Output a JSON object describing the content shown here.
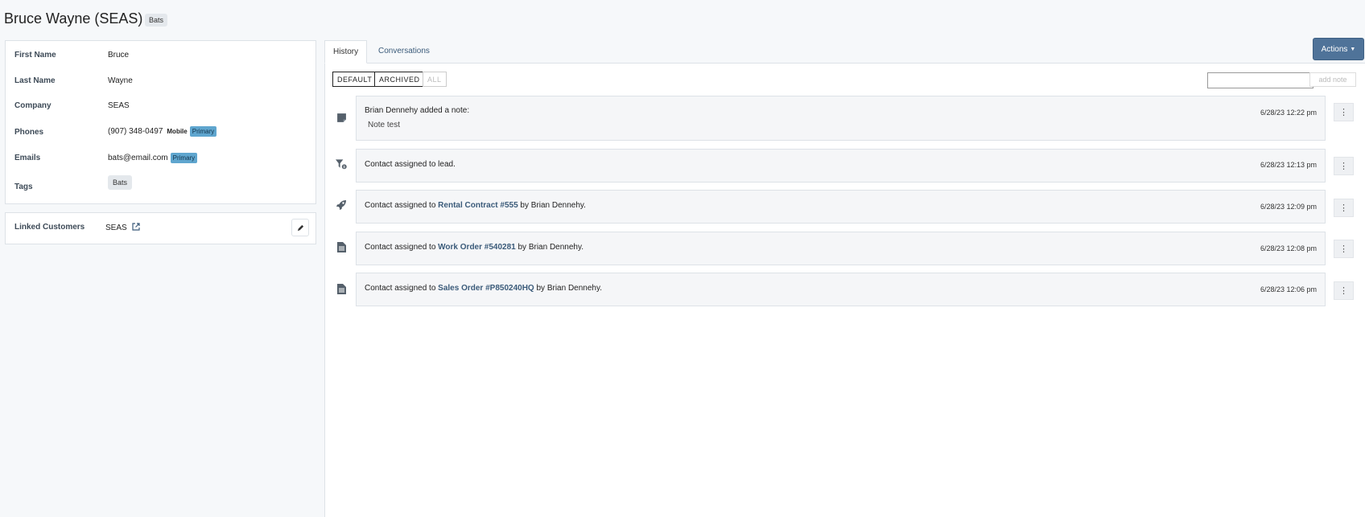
{
  "header": {
    "title": "Bruce Wayne (SEAS)",
    "tag": "Bats"
  },
  "info": {
    "first_name_label": "First Name",
    "first_name": "Bruce",
    "last_name_label": "Last Name",
    "last_name": "Wayne",
    "company_label": "Company",
    "company": "SEAS",
    "phones_label": "Phones",
    "phone": "(907) 348-0497",
    "phone_type": "Mobile",
    "phone_primary": "Primary",
    "emails_label": "Emails",
    "email": "bats@email.com",
    "email_primary": "Primary",
    "tags_label": "Tags",
    "tag": "Bats"
  },
  "linked": {
    "label": "Linked Customers",
    "value": "SEAS"
  },
  "tabs": {
    "history": "History",
    "conversations": "Conversations"
  },
  "actions_label": "Actions",
  "filters": {
    "default": "DEFAULT",
    "archived": "ARCHIVED",
    "all": "ALL"
  },
  "add_note": {
    "placeholder": "",
    "button": "add note"
  },
  "history": [
    {
      "pre": "Brian Dennehy added a note:",
      "sub": "Note test",
      "time": "6/28/23 12:22 pm",
      "icon": "note-icon"
    },
    {
      "pre": "Contact assigned to lead.",
      "time": "6/28/23 12:13 pm",
      "icon": "funnel-icon"
    },
    {
      "pre": "Contact assigned to ",
      "link": "Rental Contract #555",
      "post": " by Brian Dennehy.",
      "time": "6/28/23 12:09 pm",
      "icon": "rocket-icon"
    },
    {
      "pre": "Contact assigned to ",
      "link": "Work Order #540281",
      "post": " by Brian Dennehy.",
      "time": "6/28/23 12:08 pm",
      "icon": "document-icon"
    },
    {
      "pre": "Contact assigned to ",
      "link": "Sales Order #P850240HQ",
      "post": " by Brian Dennehy.",
      "time": "6/28/23 12:06 pm",
      "icon": "document-icon"
    }
  ]
}
